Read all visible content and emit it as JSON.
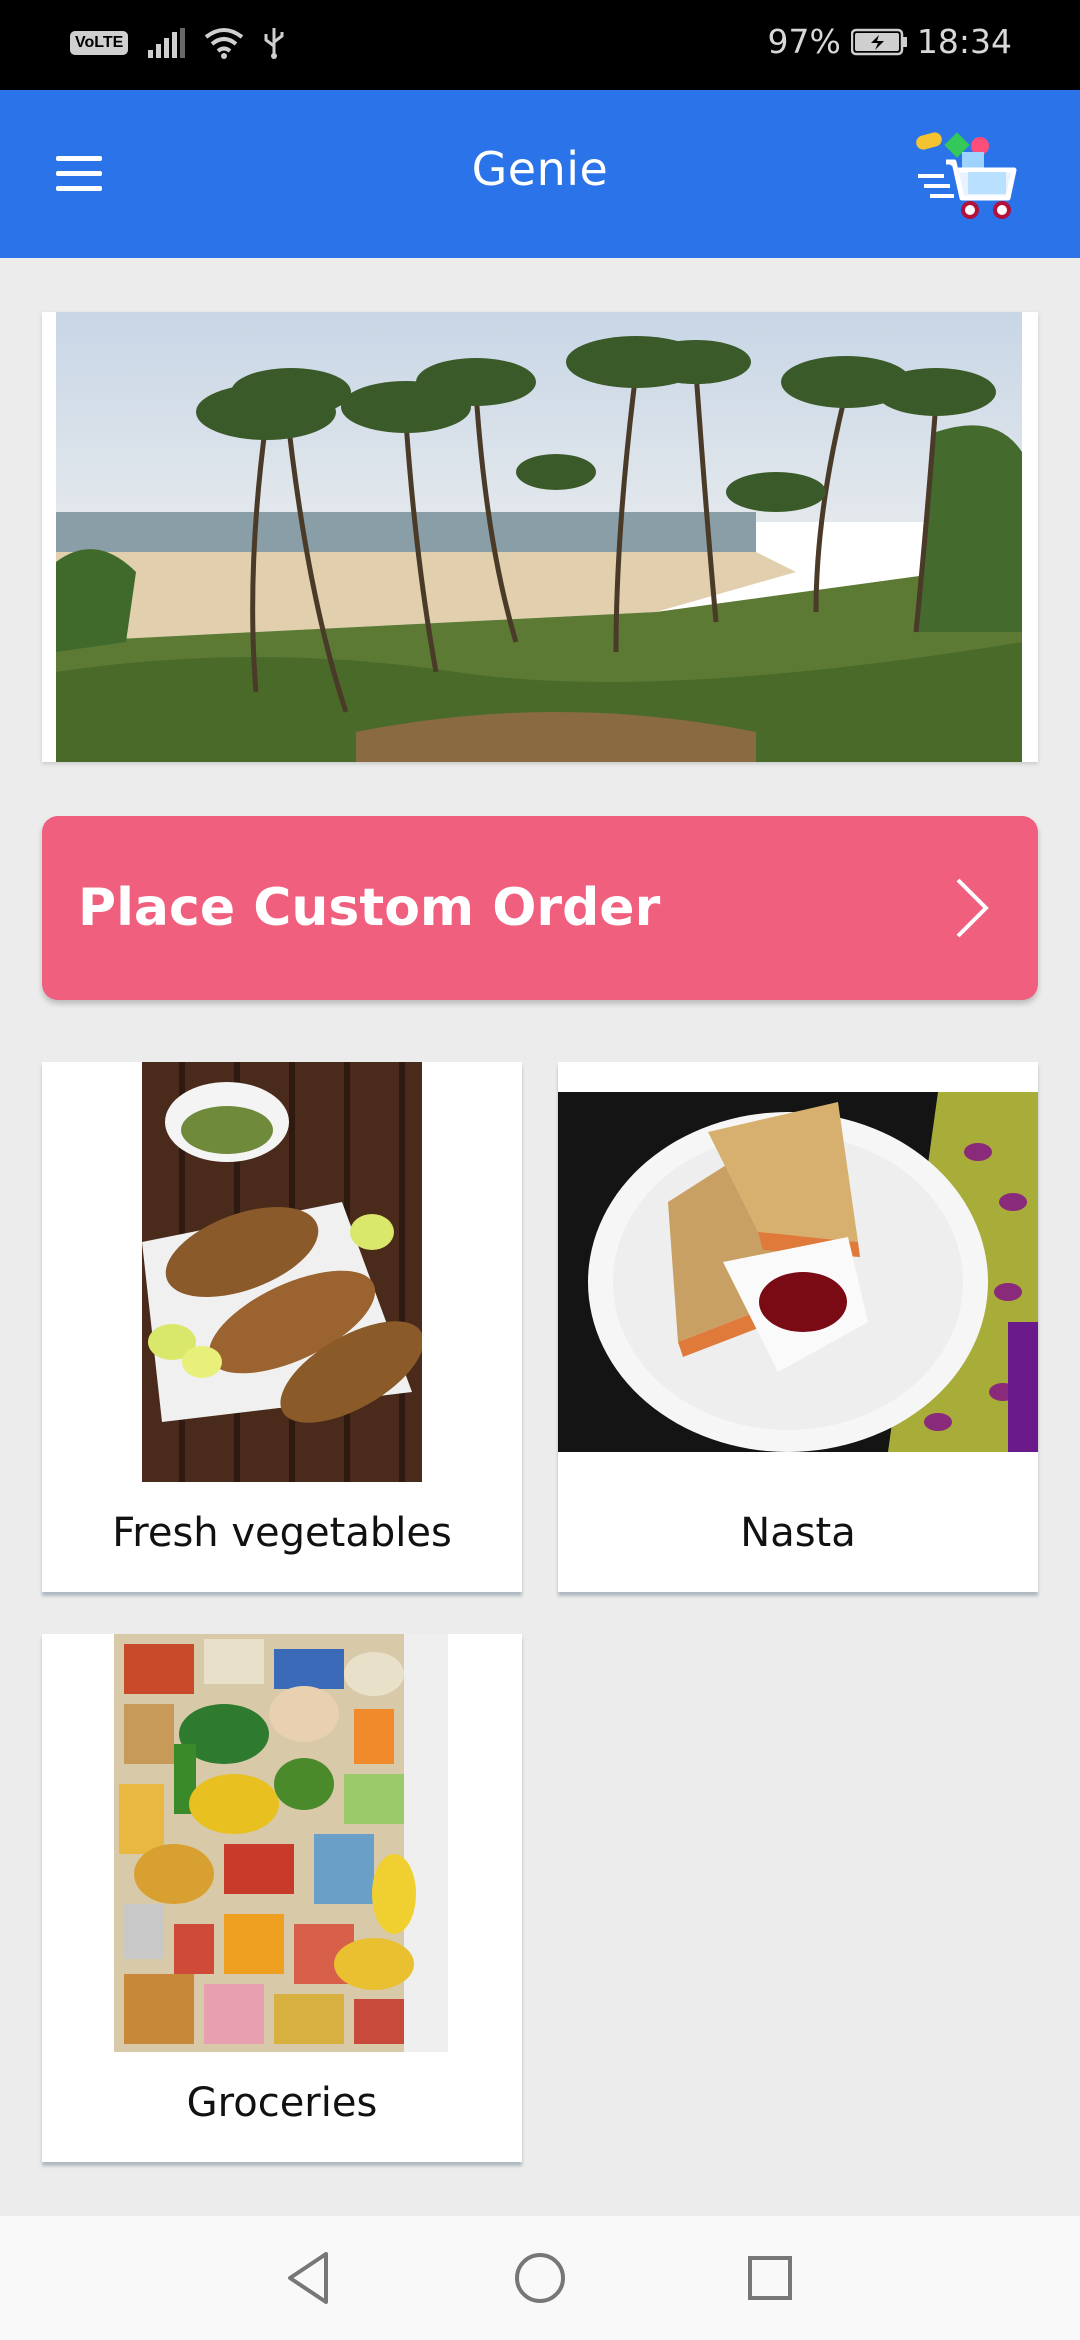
{
  "status_bar": {
    "volte_label": "VoLTE",
    "battery_percent": "97%",
    "time": "18:34",
    "icons": [
      "signal-icon",
      "wifi-icon",
      "usb-icon",
      "battery-charging-icon"
    ]
  },
  "app_bar": {
    "title": "Genie",
    "menu_icon": "hamburger-menu-icon",
    "cart_icon": "shopping-cart-icon"
  },
  "banner": {
    "image": "beach-palm-trees-photo"
  },
  "custom_order": {
    "label": "Place Custom Order",
    "icon": "chevron-right-icon",
    "color": "#f05f7e"
  },
  "categories": [
    {
      "label": "Fresh vegetables",
      "image": "fried-fish-photo"
    },
    {
      "label": "Nasta",
      "image": "sandwich-photo"
    },
    {
      "label": "Groceries",
      "image": "groceries-photo"
    }
  ],
  "nav_bar": {
    "icons": [
      "back-triangle-icon",
      "home-circle-icon",
      "recents-square-icon"
    ]
  },
  "colors": {
    "app_bar": "#2b73e8",
    "background": "#ececec",
    "accent": "#f05f7e"
  }
}
